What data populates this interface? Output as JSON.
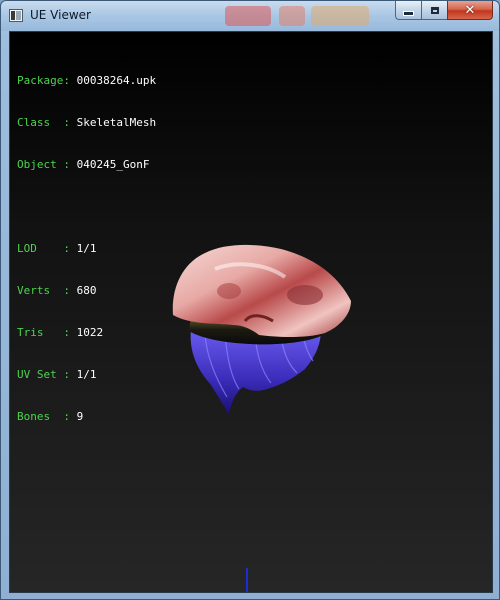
{
  "window": {
    "title": "UE Viewer",
    "buttons": {
      "minimize": "minimize",
      "maximize": "maximize",
      "close": "close"
    }
  },
  "info": {
    "package": {
      "key": "Package:",
      "value": "00038264.upk"
    },
    "class": {
      "key": "Class  :",
      "value": "SkeletalMesh"
    },
    "object": {
      "key": "Object :",
      "value": "040245_GonF"
    },
    "lod": {
      "key": "LOD    :",
      "value": "1/1"
    },
    "verts": {
      "key": "Verts  :",
      "value": "680"
    },
    "tris": {
      "key": "Tris   :",
      "value": "1022"
    },
    "uvset": {
      "key": "UV Set :",
      "value": "1/1"
    },
    "bones": {
      "key": "Bones  :",
      "value": "9"
    }
  },
  "colors": {
    "label": "#4cd34c",
    "value": "#ffffff",
    "hat": "#e8b9b6",
    "hair": "#4b3bd6",
    "axis": "#1e2bd8"
  },
  "icons": {
    "app": "ue-viewer-app-icon",
    "min": "minimize-icon",
    "max": "maximize-icon",
    "close": "close-icon"
  }
}
